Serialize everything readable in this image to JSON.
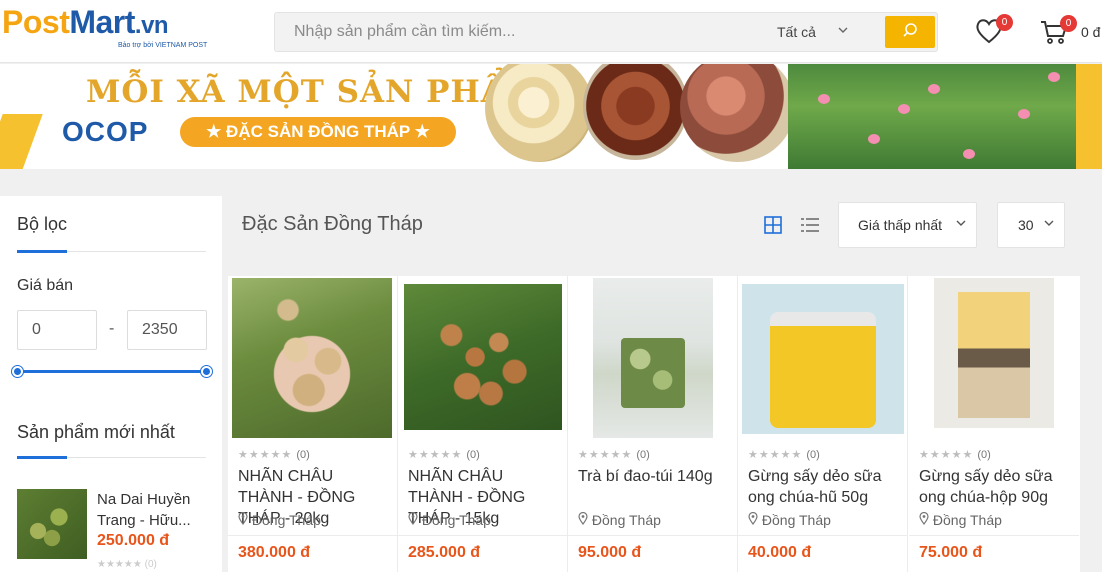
{
  "header": {
    "logo_post": "Post",
    "logo_mart": "Mart",
    "logo_vn": ".vn",
    "logo_sub": "Bảo trợ bởi VIETNAM POST",
    "search_placeholder": "Nhập sản phẩm cần tìm kiếm...",
    "search_category": "Tất cả",
    "wishlist_count": "0",
    "cart_count": "0",
    "cart_total": "0 đ"
  },
  "banner": {
    "title": "MỖI XÃ MỘT SẢN PHẨM",
    "ocop": "OCOP",
    "subtitle": "★ ĐẶC SẢN ĐỒNG THÁP ★"
  },
  "sidebar": {
    "filter_title": "Bộ lọc",
    "price_label": "Giá bán",
    "price_min": "0",
    "price_max": "2350",
    "price_dash": "-",
    "newest_title": "Sản phẩm mới nhất",
    "newest": {
      "name": "Na Dai Huyền Trang - Hữu...",
      "price": "250.000 đ",
      "stars": "★★★★★",
      "reviews": "(0)"
    }
  },
  "main": {
    "title": "Đặc Sản Đồng Tháp",
    "sort_value": "Giá thấp nhất",
    "count_value": "30"
  },
  "products": [
    {
      "name": "NHÃN CHÂU THÀNH - ĐỒNG THÁP - 20kg",
      "location": "Đồng Tháp",
      "price": "380.000 đ",
      "stars": "★★★★★",
      "reviews": "(0)"
    },
    {
      "name": "NHÃN CHÂU THÀNH - ĐỒNG THÁP - 15kg",
      "location": "Đồng Tháp",
      "price": "285.000 đ",
      "stars": "★★★★★",
      "reviews": "(0)"
    },
    {
      "name": "Trà bí đao-túi 140g",
      "location": "Đồng Tháp",
      "price": "95.000 đ",
      "stars": "★★★★★",
      "reviews": "(0)"
    },
    {
      "name": "Gừng sấy dẻo sữa ong chúa-hũ 50g",
      "location": "Đồng Tháp",
      "price": "40.000 đ",
      "stars": "★★★★★",
      "reviews": "(0)"
    },
    {
      "name": "Gừng sấy dẻo sữa ong chúa-hộp 90g",
      "location": "Đồng Tháp",
      "price": "75.000 đ",
      "stars": "★★★★★",
      "reviews": "(0)"
    }
  ],
  "colors": {
    "accent_blue": "#1e6fd9",
    "price_orange": "#e8551b",
    "search_button": "#f4b400",
    "badge_red": "#e53935"
  },
  "icons": [
    "search-icon",
    "heart-icon",
    "cart-icon",
    "grid-view-icon",
    "list-view-icon",
    "chevron-down-icon",
    "location-pin-icon"
  ]
}
